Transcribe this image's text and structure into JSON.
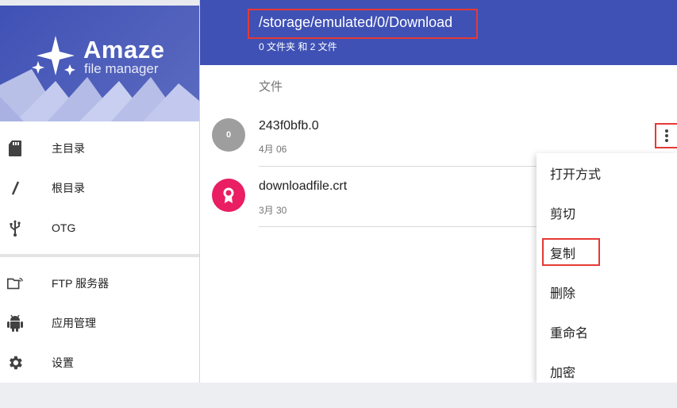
{
  "logo": {
    "title": "Amaze",
    "subtitle": "file manager"
  },
  "sidebar": {
    "items": [
      {
        "label": "主目录",
        "icon": "sd-card-icon"
      },
      {
        "label": "根目录",
        "icon": "slash-icon"
      },
      {
        "label": "OTG",
        "icon": "usb-icon"
      },
      {
        "label": "FTP 服务器",
        "icon": "ftp-folder-icon"
      },
      {
        "label": "应用管理",
        "icon": "android-icon"
      },
      {
        "label": "设置",
        "icon": "gear-icon"
      }
    ]
  },
  "toolbar": {
    "path": "/storage/emulated/0/Download",
    "summary": "0 文件夹 和 2 文件"
  },
  "main": {
    "section_header": "文件",
    "files": [
      {
        "name": "243f0bfb.0",
        "date": "4月 06",
        "avatar_text": "0",
        "avatar_color": "#9e9e9e"
      },
      {
        "name": "downloadfile.crt",
        "date": "3月 30",
        "avatar_text": "",
        "avatar_color": "#e91e63",
        "icon": "certificate-icon"
      }
    ]
  },
  "popup_menu": {
    "items": [
      "打开方式",
      "剪切",
      "复制",
      "删除",
      "重命名",
      "加密"
    ]
  },
  "colors": {
    "primary": "#3f51b5",
    "highlight": "#e53935",
    "crt_accent": "#e91e63"
  }
}
